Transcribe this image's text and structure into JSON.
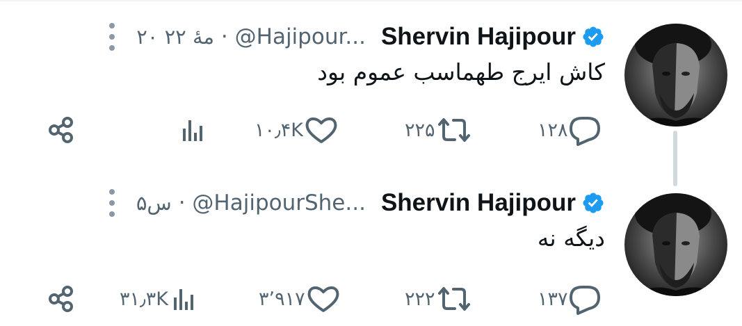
{
  "tweets": [
    {
      "display_name": "Shervin Hajipour",
      "handle": "@Hajipour...",
      "separator": "·",
      "time": "۲۰ مۀ ۲۲",
      "text": "کاش ایرج طهماسب عموم بود",
      "replies": "۱۲۸",
      "retweets": "۲۲۵",
      "likes": "۱۰٫۴K",
      "views": ""
    },
    {
      "display_name": "Shervin Hajipour",
      "handle": "@HajipourShe...",
      "separator": "·",
      "time": "۵س",
      "text": "دیگه نه",
      "replies": "۱۳۷",
      "retweets": "۲۲۲",
      "likes": "۳٬۹۱۷",
      "views": "۳۱٫۳K"
    }
  ],
  "icons": {
    "more": "more-vertical-icon",
    "verified": "verified-badge-icon",
    "reply": "reply-icon",
    "retweet": "retweet-icon",
    "like": "heart-icon",
    "views": "views-chart-icon",
    "share": "share-icon"
  },
  "colors": {
    "verified": "#1d9bf0",
    "text": "#0f1419",
    "secondary": "#536471",
    "thread_line": "#cfd9de"
  }
}
